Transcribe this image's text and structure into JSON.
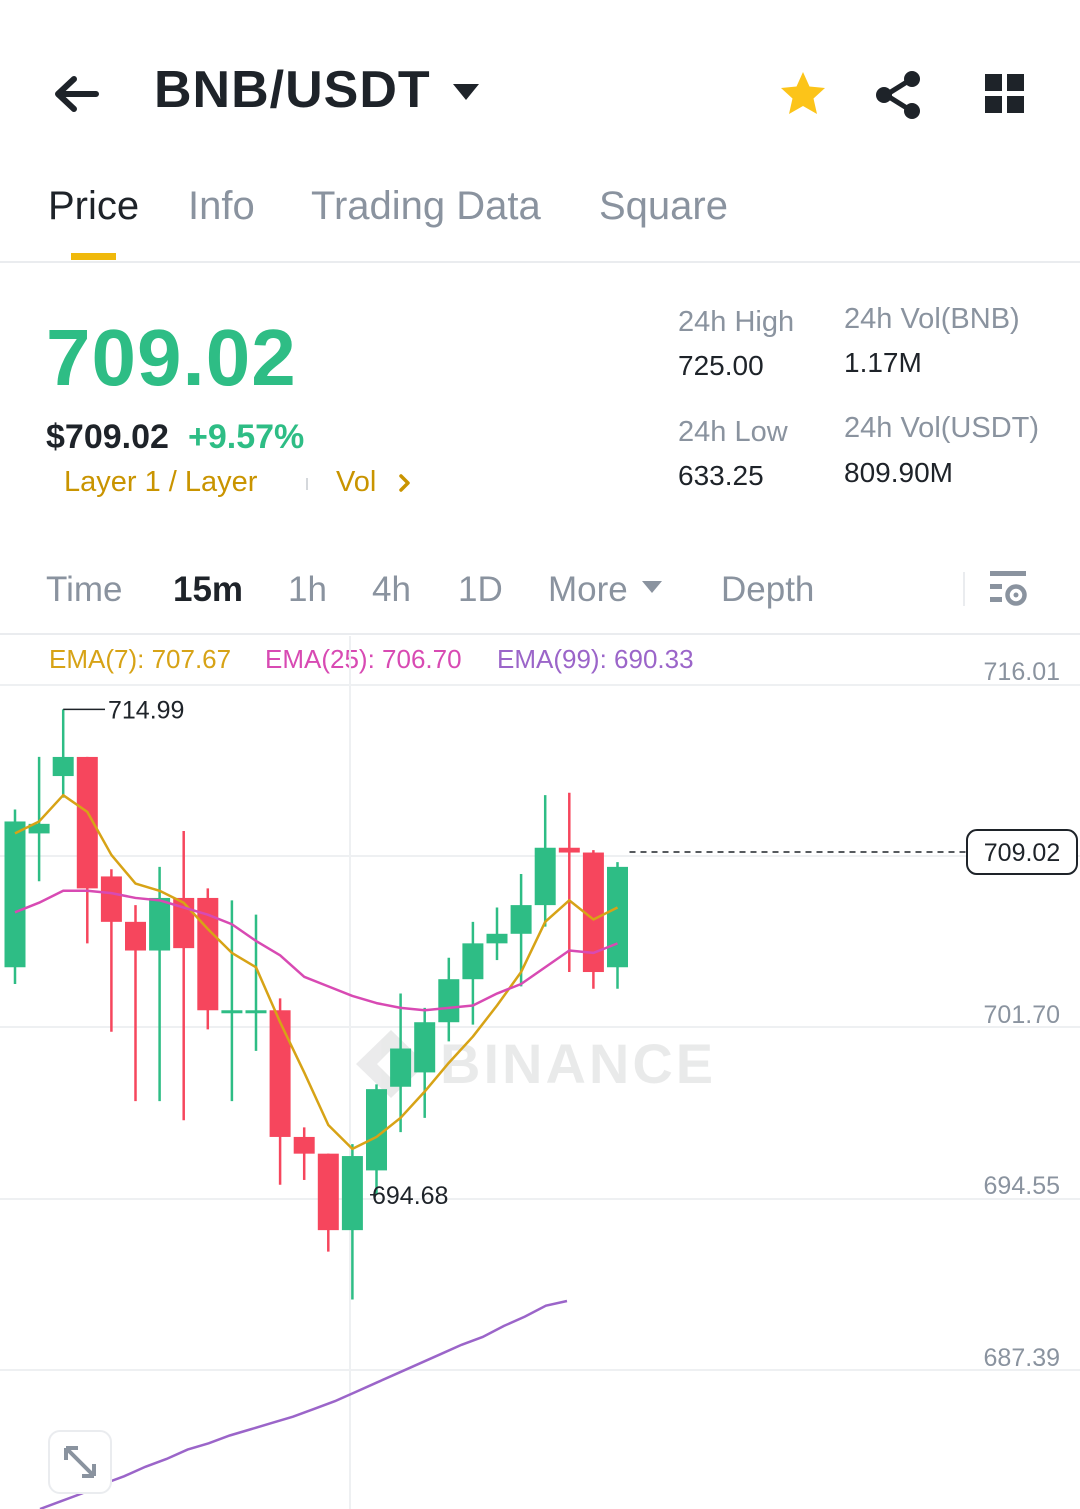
{
  "header": {
    "pair": "BNB/USDT",
    "icons": {
      "back": "arrow-left-icon",
      "favorite": "star-icon",
      "share": "share-icon",
      "menu": "grid-icon"
    },
    "favorite_color": "#fcc419"
  },
  "tabs": [
    {
      "label": "Price",
      "active": true
    },
    {
      "label": "Info",
      "active": false
    },
    {
      "label": "Trading Data",
      "active": false
    },
    {
      "label": "Square",
      "active": false
    }
  ],
  "price": {
    "last": "709.02",
    "fiat": "$709.02",
    "change": "+9.57%",
    "tag": "Layer 1 / Layer",
    "vol_label": "Vol"
  },
  "stats": {
    "high_label": "24h High",
    "high_value": "725.00",
    "low_label": "24h Low",
    "low_value": "633.25",
    "vol_base_label": "24h Vol(BNB)",
    "vol_base_value": "1.17M",
    "vol_quote_label": "24h Vol(USDT)",
    "vol_quote_value": "809.90M"
  },
  "intervals": {
    "items": [
      "Time",
      "15m",
      "1h",
      "4h",
      "1D"
    ],
    "active": "15m",
    "more": "More",
    "depth": "Depth"
  },
  "ema": [
    {
      "label": "EMA(7): 707.67",
      "color": "#d7a316"
    },
    {
      "label": "EMA(25): 706.70",
      "color": "#d84ab3"
    },
    {
      "label": "EMA(99): 690.33",
      "color": "#9b65c9"
    }
  ],
  "colors": {
    "up": "#2ebd85",
    "down": "#f6465d",
    "accent": "#f0b90b",
    "tag": "#c99400"
  },
  "chart_data": {
    "type": "candlestick",
    "y_ticks": [
      716.01,
      709.02,
      701.7,
      694.55,
      687.39
    ],
    "y_tick_labels": [
      "716.01",
      "701.70",
      "694.55",
      "687.39"
    ],
    "current_price_label": "709.02",
    "high_marker": {
      "label": "714.99",
      "value": 714.99
    },
    "low_marker": {
      "label": "694.68",
      "value": 694.68
    },
    "watermark": "BINANCE",
    "candles": [
      {
        "o": 704.2,
        "h": 710.8,
        "l": 703.5,
        "c": 710.3
      },
      {
        "o": 709.8,
        "h": 713.0,
        "l": 707.8,
        "c": 710.2
      },
      {
        "o": 712.2,
        "h": 714.99,
        "l": 711.3,
        "c": 713.0
      },
      {
        "o": 713.0,
        "h": 713.0,
        "l": 705.2,
        "c": 707.5
      },
      {
        "o": 708.0,
        "h": 708.3,
        "l": 701.5,
        "c": 706.1
      },
      {
        "o": 706.1,
        "h": 706.8,
        "l": 698.6,
        "c": 704.9
      },
      {
        "o": 704.9,
        "h": 708.4,
        "l": 698.6,
        "c": 707.1
      },
      {
        "o": 707.1,
        "h": 709.9,
        "l": 697.8,
        "c": 705.0
      },
      {
        "o": 707.1,
        "h": 707.5,
        "l": 701.6,
        "c": 702.4
      },
      {
        "o": 702.4,
        "h": 707.0,
        "l": 698.6,
        "c": 702.4
      },
      {
        "o": 702.4,
        "h": 706.4,
        "l": 700.7,
        "c": 702.4
      },
      {
        "o": 702.4,
        "h": 702.9,
        "l": 695.1,
        "c": 697.1
      },
      {
        "o": 697.1,
        "h": 697.5,
        "l": 695.3,
        "c": 696.4
      },
      {
        "o": 696.4,
        "h": 696.4,
        "l": 692.3,
        "c": 693.2
      },
      {
        "o": 693.2,
        "h": 696.8,
        "l": 690.3,
        "c": 696.3
      },
      {
        "o": 695.7,
        "h": 699.3,
        "l": 694.68,
        "c": 699.1
      },
      {
        "o": 699.2,
        "h": 703.1,
        "l": 697.3,
        "c": 700.8
      },
      {
        "o": 699.8,
        "h": 702.5,
        "l": 697.9,
        "c": 701.9
      },
      {
        "o": 701.9,
        "h": 704.6,
        "l": 701.1,
        "c": 703.7
      },
      {
        "o": 703.7,
        "h": 706.1,
        "l": 701.8,
        "c": 705.2
      },
      {
        "o": 705.2,
        "h": 706.7,
        "l": 704.5,
        "c": 705.6
      },
      {
        "o": 705.6,
        "h": 708.1,
        "l": 703.4,
        "c": 706.8
      },
      {
        "o": 706.8,
        "h": 711.4,
        "l": 705.9,
        "c": 709.2
      },
      {
        "o": 709.2,
        "h": 711.5,
        "l": 704.0,
        "c": 709.0
      },
      {
        "o": 709.0,
        "h": 709.1,
        "l": 703.3,
        "c": 704.0
      },
      {
        "o": 704.2,
        "h": 708.6,
        "l": 703.3,
        "c": 708.4
      }
    ],
    "ema7": [
      709.8,
      710.3,
      711.4,
      710.7,
      708.9,
      707.7,
      707.4,
      706.9,
      705.8,
      704.8,
      704.2,
      701.9,
      699.8,
      697.6,
      696.6,
      697.1,
      697.9,
      699.0,
      700.2,
      701.3,
      702.6,
      704.0,
      706.1,
      707.0,
      706.2,
      706.7
    ],
    "ema25": [
      706.5,
      706.9,
      707.4,
      707.4,
      707.3,
      707.1,
      707.0,
      706.7,
      706.4,
      706.0,
      705.3,
      704.7,
      703.8,
      703.4,
      703.0,
      702.7,
      702.5,
      702.4,
      702.5,
      702.6,
      703.1,
      703.5,
      704.2,
      704.9,
      704.8,
      705.2
    ],
    "ema99": [
      680.1,
      680.6,
      681.1,
      681.7,
      682.2,
      682.8,
      683.3,
      683.9,
      684.3,
      684.8,
      685.2,
      685.6,
      686.0,
      686.5,
      687.0,
      687.6,
      688.2,
      688.8,
      689.4,
      690.0,
      690.6,
      691.1,
      691.8,
      692.4,
      693.1,
      693.4
    ]
  }
}
